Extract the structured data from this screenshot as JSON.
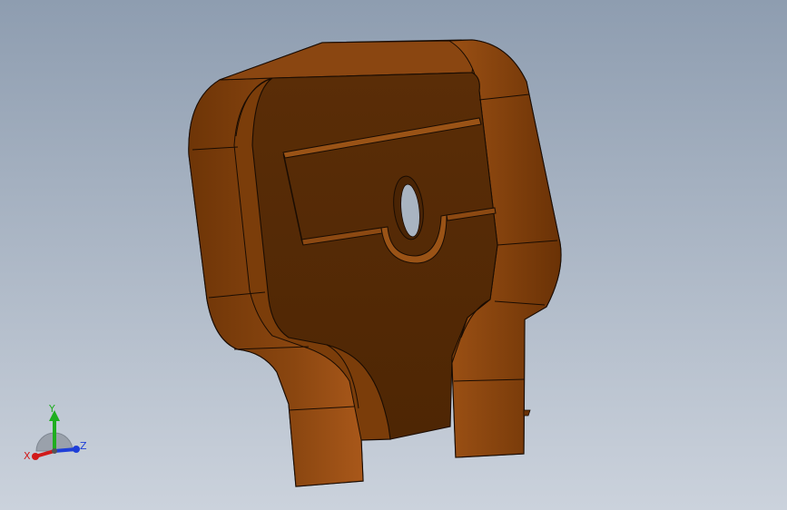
{
  "viewport": {
    "background_top": "#8e9db0",
    "background_bottom": "#cbd2dc",
    "part_color": "#5a2c06",
    "part_highlight": "#8b4a10",
    "edge_color": "#1a0c02"
  },
  "triad": {
    "x_label": "X",
    "y_label": "Y",
    "z_label": "Z",
    "x_color": "#d11a1a",
    "y_color": "#1fae1f",
    "z_color": "#1f3fd8"
  }
}
